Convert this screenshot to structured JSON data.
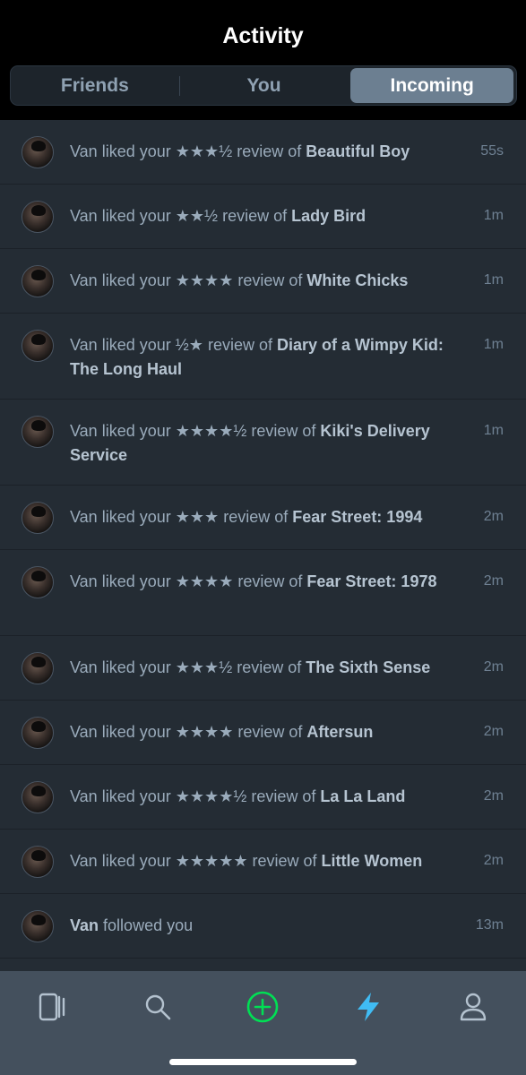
{
  "header": {
    "title": "Activity"
  },
  "tabs": [
    {
      "label": "Friends",
      "active": false
    },
    {
      "label": "You",
      "active": false
    },
    {
      "label": "Incoming",
      "active": true
    }
  ],
  "rows": [
    {
      "user": "Van",
      "pre": "liked your",
      "stars": "★★★½",
      "mid": "review of",
      "film": "Beautiful Boy",
      "time": "55s"
    },
    {
      "user": "Van",
      "pre": "liked your",
      "stars": "★★½",
      "mid": "review of",
      "film": "Lady Bird",
      "time": "1m"
    },
    {
      "user": "Van",
      "pre": "liked your",
      "stars": "★★★★",
      "mid": "review of",
      "film": "White Chicks",
      "time": "1m"
    },
    {
      "user": "Van",
      "pre": "liked your",
      "stars": "½★",
      "mid": "review of",
      "film": "Diary of a Wimpy Kid: The Long Haul",
      "time": "1m"
    },
    {
      "user": "Van",
      "pre": "liked your",
      "stars": "★★★★½",
      "mid": "review of",
      "film": "Kiki's Delivery Service",
      "time": "1m"
    },
    {
      "user": "Van",
      "pre": "liked your",
      "stars": "★★★",
      "mid": "review of",
      "film": "Fear Street: 1994",
      "time": "2m"
    },
    {
      "user": "Van",
      "pre": "liked your",
      "stars": "★★★★",
      "mid": "review of",
      "film": "Fear Street: 1978",
      "time": "2m"
    },
    {
      "user": "Van",
      "pre": "liked your",
      "stars": "★★★½",
      "mid": "review of",
      "film": "The Sixth Sense",
      "time": "2m"
    },
    {
      "user": "Van",
      "pre": "liked your",
      "stars": "★★★★",
      "mid": "review of",
      "film": "Aftersun",
      "time": "2m"
    },
    {
      "user": "Van",
      "pre": "liked your",
      "stars": "★★★★½",
      "mid": "review of",
      "film": "La La Land",
      "time": "2m"
    },
    {
      "user": "Van",
      "pre": "liked your",
      "stars": "★★★★★",
      "mid": "review of",
      "film": "Little Women",
      "time": "2m"
    }
  ],
  "follow_row": {
    "user": "Van",
    "text": "followed you",
    "time": "13m"
  },
  "tabbar": [
    {
      "icon": "films-icon",
      "active": false
    },
    {
      "icon": "search-icon",
      "active": false
    },
    {
      "icon": "add-icon",
      "active": false,
      "color": "#00e054"
    },
    {
      "icon": "activity-bolt-icon",
      "active": true,
      "color": "#40bcf4"
    },
    {
      "icon": "profile-icon",
      "active": false
    }
  ]
}
